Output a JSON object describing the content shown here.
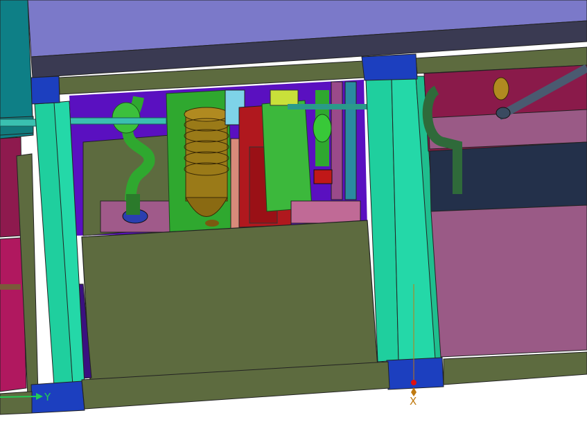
{
  "viewport": {
    "background": "#ffffff"
  },
  "triad": {
    "y_label": "Y",
    "x_label": "X",
    "y_color": "#22cc55",
    "x_color": "#c07a10",
    "origin_color": "#e01010"
  },
  "colors": {
    "roof": "#7b79c9",
    "roof_edge": "#3a3a52",
    "frame_olive": "#5d6b3f",
    "column_cyan": "#1fcf9e",
    "bracket_blue": "#1c3fbf",
    "left_teal": "#0e7f86",
    "left_magenta": "#b0185f",
    "purple_bg": "#5a10c0",
    "right_maroon": "#8a1a4a",
    "right_mauve": "#9a5a86",
    "right_navy": "#23304a",
    "pipe_green": "#2fa82f",
    "pipe_yellow": "#c9e03a",
    "tank_gold": "#9a7a18",
    "red_panel": "#b0181e",
    "light_blue": "#7ed3e8",
    "salmon": "#d88a7a"
  }
}
